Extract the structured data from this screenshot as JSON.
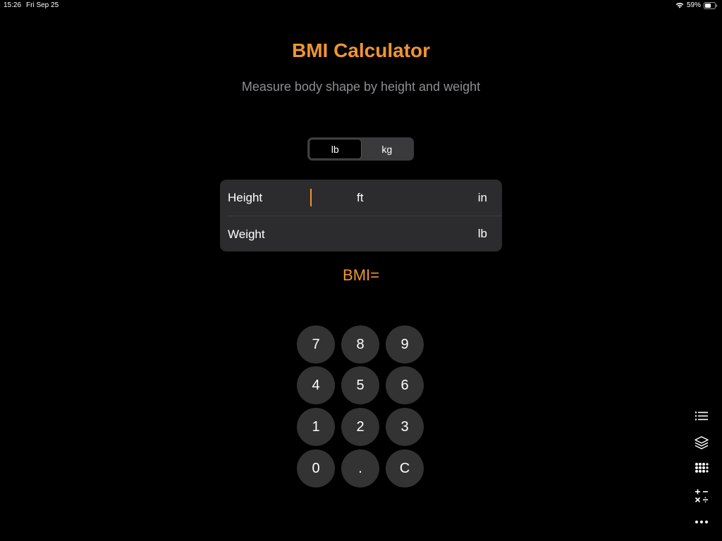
{
  "status_bar": {
    "time": "15:26",
    "date": "Fri Sep 25",
    "battery": "59%"
  },
  "header": {
    "title": "BMI Calculator",
    "subtitle": "Measure body shape by height and weight"
  },
  "units": {
    "options": [
      "lb",
      "kg"
    ],
    "selected": "lb"
  },
  "form": {
    "height_label": "Height",
    "height_feet_unit": "ft",
    "height_inches_unit": "in",
    "weight_label": "Weight",
    "weight_unit": "lb"
  },
  "result": {
    "label": "BMI="
  },
  "keypad": {
    "keys": [
      "7",
      "8",
      "9",
      "4",
      "5",
      "6",
      "1",
      "2",
      "3",
      "0",
      ".",
      "C"
    ]
  },
  "toolbar": {
    "icons": [
      "list-icon",
      "layers-icon",
      "grid-icon",
      "operators-icon",
      "more-icon"
    ]
  },
  "colors": {
    "accent": "#f0952f",
    "background": "#000000",
    "panel": "#2c2c2e",
    "key": "#333333",
    "secondary_text": "#8e8e93"
  }
}
